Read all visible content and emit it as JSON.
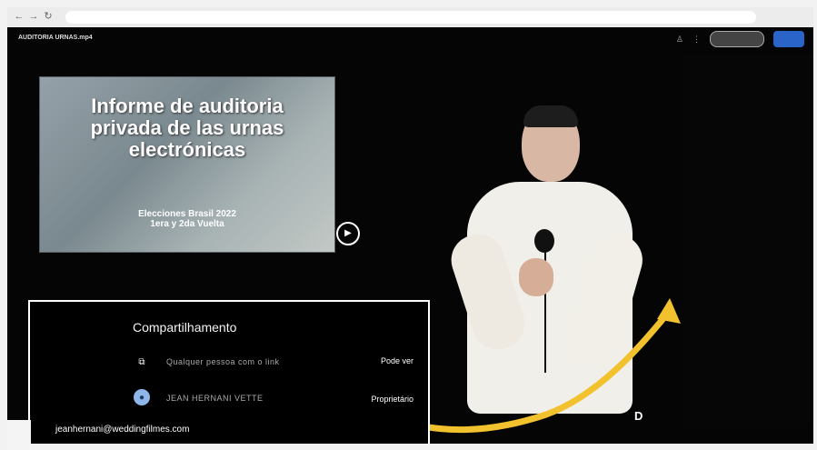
{
  "browser": {
    "back": "←",
    "forward": "→",
    "reload": "↻",
    "url": ""
  },
  "document": {
    "title": "AUDITORIA URNAS.mp4",
    "share_label": "",
    "primary_label": ""
  },
  "slide": {
    "title_line_1": "Informe de auditoria",
    "title_line_2": "privada de las urnas",
    "title_line_3": "electrónicas",
    "subtitle_line_1": "Elecciones Brasil 2022",
    "subtitle_line_2": "1era y 2da Vuelta"
  },
  "video": {
    "play": "▶",
    "marker": "D"
  },
  "sharing": {
    "title": "Compartilhamento",
    "rows": [
      {
        "name": "Qualquer pessoa com o link",
        "role": "Pode ver",
        "icon": "link-icon"
      },
      {
        "name": "JEAN HERNANI VETTE",
        "role": "Proprietário",
        "icon": "avatar-icon"
      }
    ],
    "email": "jeanhernani@weddingfilmes.com"
  },
  "panel": {
    "heading_1": "",
    "heading_2": "",
    "section_1": "",
    "section_2": "",
    "section_3": "",
    "section_4": ""
  },
  "colors": {
    "accent": "#f2c12e",
    "blue_button": "#2a64c8",
    "background": "#050505"
  }
}
